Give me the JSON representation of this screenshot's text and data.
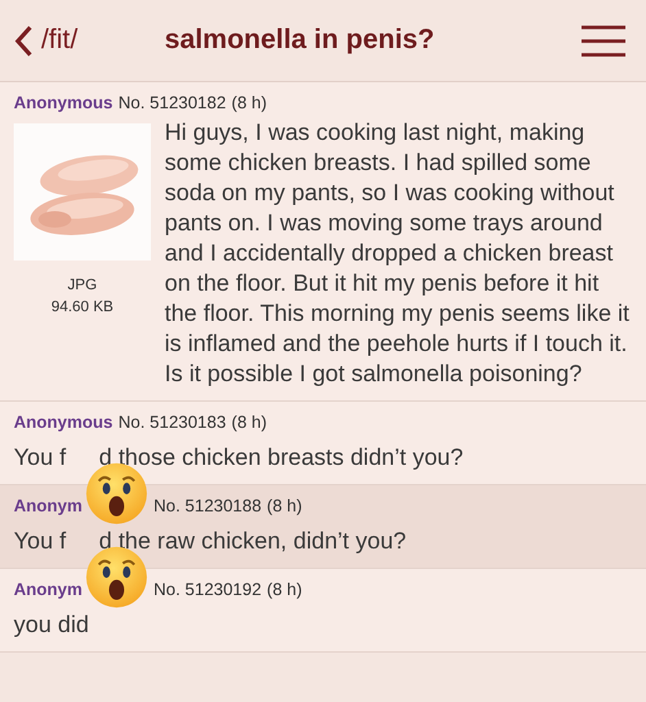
{
  "header": {
    "back": "/fit/",
    "title": "salmonella in penis?"
  },
  "op": {
    "name": "Anonymous",
    "number": "No. 51230182",
    "age": "(8 h)",
    "file_type": "JPG",
    "file_size": "94.60 KB",
    "text": "Hi guys, I was cooking last night, making some chicken breasts. I had spilled some soda on my pants, so I was cooking without pants on. I was moving some trays around and I accidentally dropped a chicken breast on the floor. But it hit my penis before it hit the floor. This morning my penis seems like it is inflamed and the peehole hurts if I touch it. Is it possible I got salmonella poisoning?"
  },
  "replies": [
    {
      "name": [
        "Anonymous"
      ],
      "number": "No. 51230183",
      "age": "(8 h)",
      "text": [
        "You f",
        "d those chicken breasts didn’t you?"
      ],
      "shaded": false,
      "sticker": true
    },
    {
      "name": [
        "Anonym"
      ],
      "number": "No. 51230188",
      "age": "(8 h)",
      "text": [
        "You f",
        "d the raw chicken, didn’t you?"
      ],
      "shaded": true,
      "sticker": true
    },
    {
      "name": [
        "Anonym"
      ],
      "number": "No. 51230192",
      "age": "(8 h)",
      "text": [
        "you did"
      ],
      "shaded": false,
      "sticker": false
    }
  ]
}
